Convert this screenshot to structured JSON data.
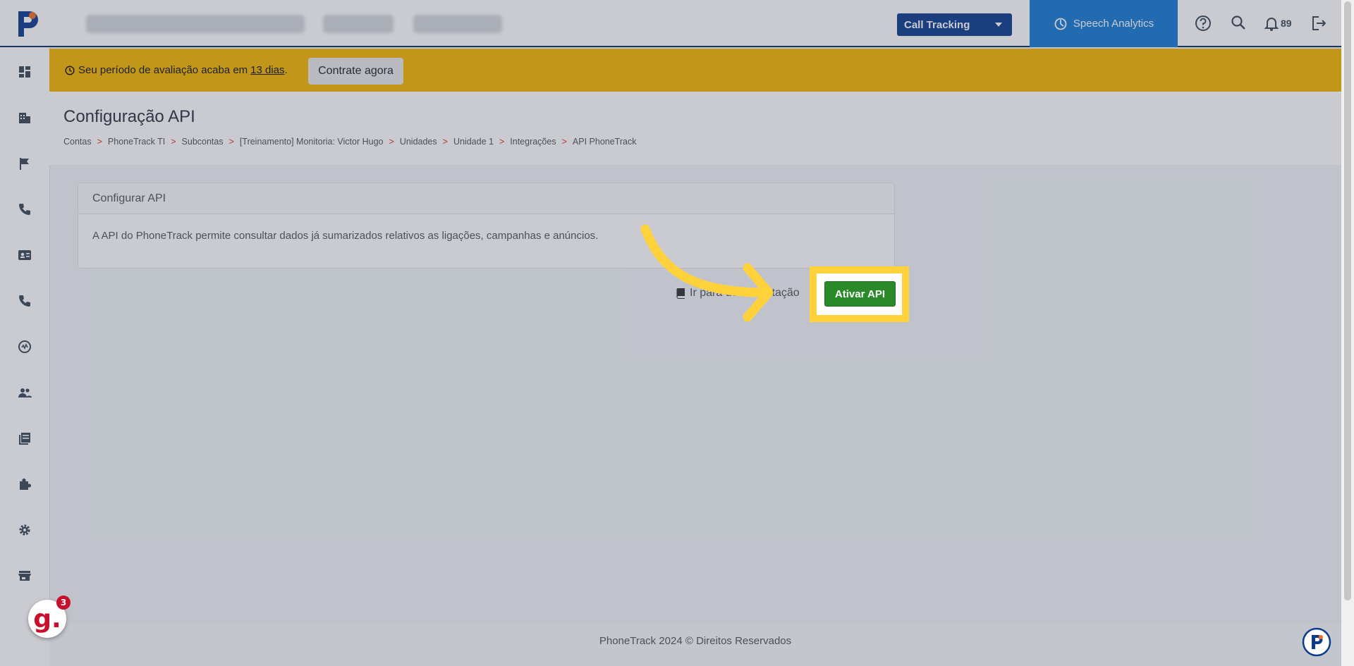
{
  "header": {
    "product_select": "Call Tracking",
    "speech_analytics": "Speech Analytics",
    "notifications_count": "89"
  },
  "banner": {
    "text_prefix": "Seu período de avaliação acaba em",
    "days_link": "13 dias",
    "text_suffix": ".",
    "cta": "Contrate agora"
  },
  "page": {
    "title": "Configuração API",
    "breadcrumb": [
      "Contas",
      "PhoneTrack TI",
      "Subcontas",
      "[Treinamento] Monitoria: Victor Hugo",
      "Unidades",
      "Unidade 1",
      "Integrações",
      "API PhoneTrack"
    ],
    "breadcrumb_sep": ">"
  },
  "card": {
    "header": "Configurar API",
    "body": "A API do PhoneTrack permite consultar dados já sumarizados relativos as ligações, campanhas e anúncios."
  },
  "doc_link": "Ir para documentação",
  "activate_button": "Ativar API",
  "footer": {
    "copyright": "PhoneTrack 2024 © Direitos Reservados"
  },
  "chat_badge": {
    "letter": "g.",
    "count": "3"
  },
  "colors": {
    "brand_blue": "#0d3c8c",
    "speech_blue": "#1a7bd1",
    "banner_yellow": "#f6b800",
    "button_green": "#2a8a2a",
    "highlight_yellow": "#ffd23c",
    "breadcrumb_sep": "#e0301e"
  }
}
